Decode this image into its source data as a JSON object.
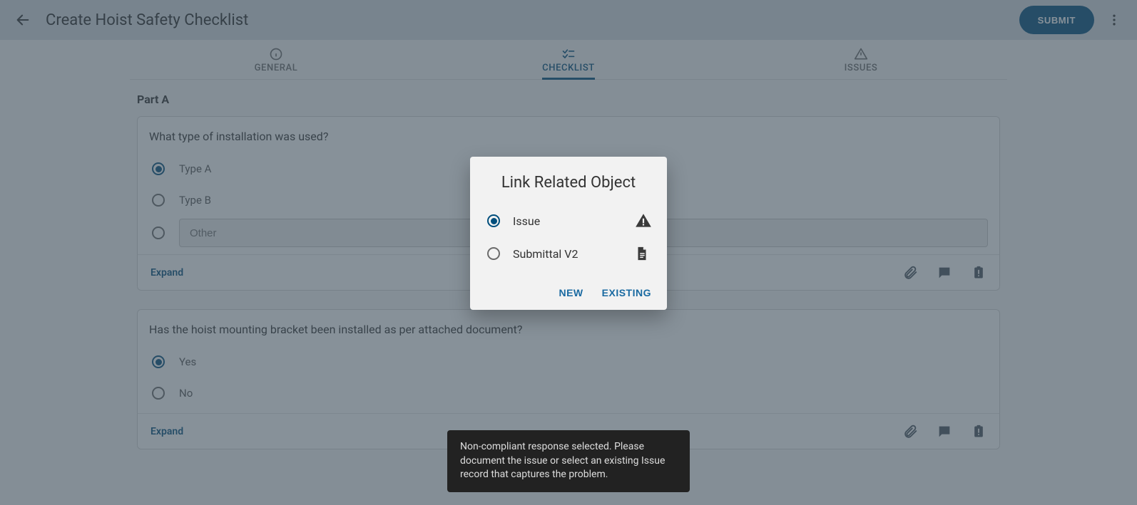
{
  "header": {
    "title": "Create Hoist Safety Checklist",
    "submit_label": "SUBMIT"
  },
  "tabs": {
    "general": "GENERAL",
    "checklist": "CHECKLIST",
    "issues": "ISSUES"
  },
  "section": {
    "part_a": "Part A"
  },
  "card1": {
    "question": "What type of installation was used?",
    "opt_a": "Type A",
    "opt_b": "Type B",
    "other_placeholder": "Other",
    "expand": "Expand"
  },
  "card2": {
    "question": "Has the hoist mounting bracket been installed as per attached document?",
    "yes": "Yes",
    "no": "No",
    "expand": "Expand"
  },
  "dialog": {
    "title": "Link Related Object",
    "opt_issue": "Issue",
    "opt_submittal": "Submittal V2",
    "btn_new": "NEW",
    "btn_existing": "EXISTING"
  },
  "toast": {
    "message": "Non-compliant response selected. Please document the issue or select an existing Issue record that captures the problem."
  }
}
